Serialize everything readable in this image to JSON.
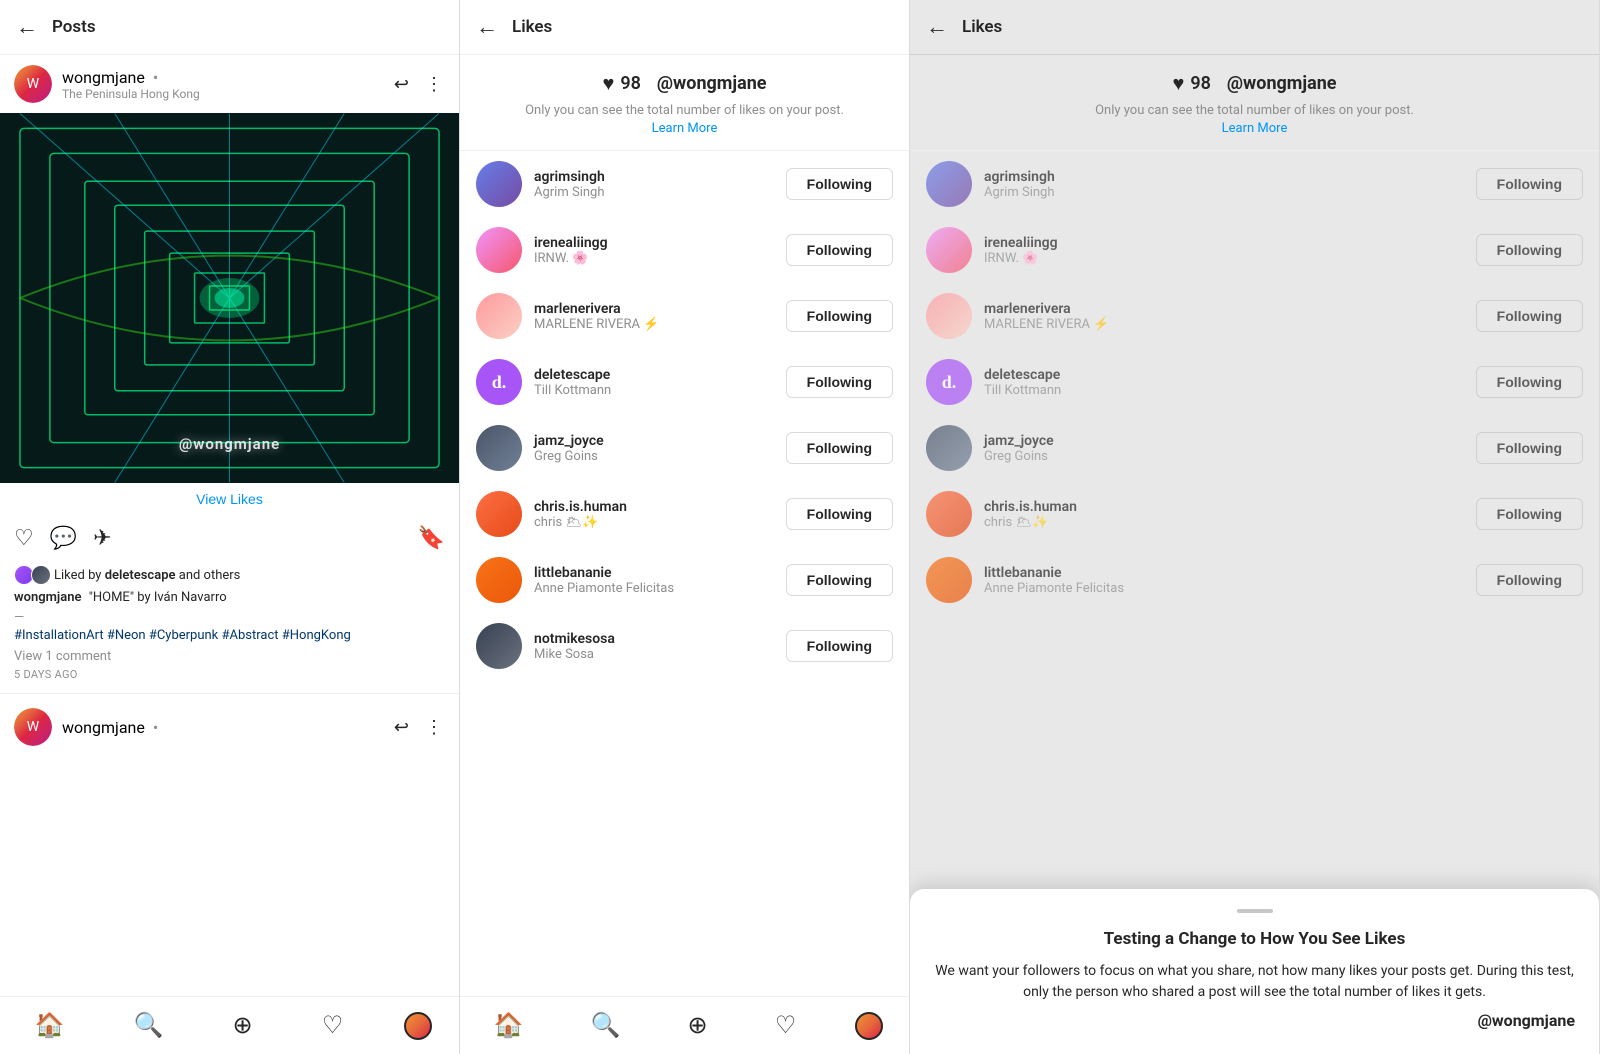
{
  "panel1": {
    "header": {
      "back_label": "←",
      "title": "Posts",
      "reply_icon": "↩",
      "more_icon": "⋮"
    },
    "post": {
      "username": "wongmjane",
      "dot": "•",
      "subtitle": "The Peninsula Hong Kong",
      "watermark": "@wongmjane",
      "view_likes": "View Likes",
      "liked_by": "Liked by",
      "liked_user": "deletescape",
      "liked_others": "and others",
      "caption_user": "wongmjane",
      "caption_text": "\"HOME\" by Iván Navarro",
      "em_dash": "—",
      "hashtags": "#InstallationArt #Neon #Cyberpunk #Abstract #HongKong",
      "comments": "View 1 comment",
      "timestamp": "5 days ago"
    },
    "second_post": {
      "username": "wongmjane",
      "dot": "•"
    },
    "nav": {
      "home": "⌂",
      "search": "🔍",
      "plus": "⊕",
      "heart": "♡",
      "profile": ""
    }
  },
  "panel2": {
    "header": {
      "back_label": "←",
      "title": "Likes"
    },
    "likes_count": "98",
    "watermark": "@wongmjane",
    "info_text": "Only you can see the total number of likes on your post.",
    "learn_more": "Learn More",
    "users": [
      {
        "username": "agrimsingh",
        "display_name": "Agrim Singh",
        "avatar_class": "av-agrimsingh",
        "avatar_text": "",
        "following": "Following"
      },
      {
        "username": "irenealiingg",
        "display_name": "IRNW. 🌸",
        "avatar_class": "av-irenealingg",
        "avatar_text": "",
        "following": "Following"
      },
      {
        "username": "marlenerivera",
        "display_name": "MARLENE RIVERA ⚡",
        "avatar_class": "av-marlenerivera",
        "avatar_text": "",
        "following": "Following"
      },
      {
        "username": "deletescape",
        "display_name": "Till Kottmann",
        "avatar_class": "av-deletescape",
        "avatar_text": "d.",
        "following": "Following"
      },
      {
        "username": "jamz_joyce",
        "display_name": "Greg Goins",
        "avatar_class": "av-jamzjoyce",
        "avatar_text": "",
        "following": "Following"
      },
      {
        "username": "chris.is.human",
        "display_name": "chris 🌥✨",
        "avatar_class": "av-chrishuman",
        "avatar_text": "",
        "following": "Following"
      },
      {
        "username": "littlebananie",
        "display_name": "Anne Piamonte Felicitas",
        "avatar_class": "av-littlebananie",
        "avatar_text": "",
        "following": "Following"
      },
      {
        "username": "notmikesosa",
        "display_name": "Mike Sosa",
        "avatar_class": "av-notmikesosa",
        "avatar_text": "",
        "following": "Following"
      }
    ]
  },
  "panel3": {
    "header": {
      "back_label": "←",
      "title": "Likes"
    },
    "likes_count": "98",
    "watermark": "@wongmjane",
    "info_text": "Only you can see the total number of likes on your post.",
    "learn_more": "Learn More",
    "users": [
      {
        "username": "agrimsingh",
        "display_name": "Agrim Singh",
        "avatar_class": "av-agrimsingh",
        "avatar_text": "",
        "following": "Following"
      },
      {
        "username": "irenealiingg",
        "display_name": "IRNW. 🌸",
        "avatar_class": "av-irenealingg",
        "avatar_text": "",
        "following": "Following"
      },
      {
        "username": "marlenerivera",
        "display_name": "MARLENE RIVERA ⚡",
        "avatar_class": "av-marlenerivera",
        "avatar_text": "",
        "following": "Following"
      },
      {
        "username": "deletescape",
        "display_name": "Till Kottmann",
        "avatar_class": "av-deletescape",
        "avatar_text": "d.",
        "following": "Following"
      },
      {
        "username": "jamz_joyce",
        "display_name": "Greg Goins",
        "avatar_class": "av-jamzjoyce",
        "avatar_text": "",
        "following": "Following"
      },
      {
        "username": "chris.is.human",
        "display_name": "chris 🌥✨",
        "avatar_class": "av-chrishuman",
        "avatar_text": "",
        "following": "Following"
      },
      {
        "username": "littlebananie",
        "display_name": "Anne Piamonte Felicitas",
        "avatar_class": "av-littlebananie",
        "avatar_text": "",
        "following": "Following"
      }
    ],
    "overlay": {
      "title": "Testing a Change to How You See Likes",
      "text": "We want your followers to focus on what you share, not how many likes your posts get. During this test, only the person who shared a post will see the total number of likes it gets.",
      "watermark": "@wongmjane"
    }
  }
}
